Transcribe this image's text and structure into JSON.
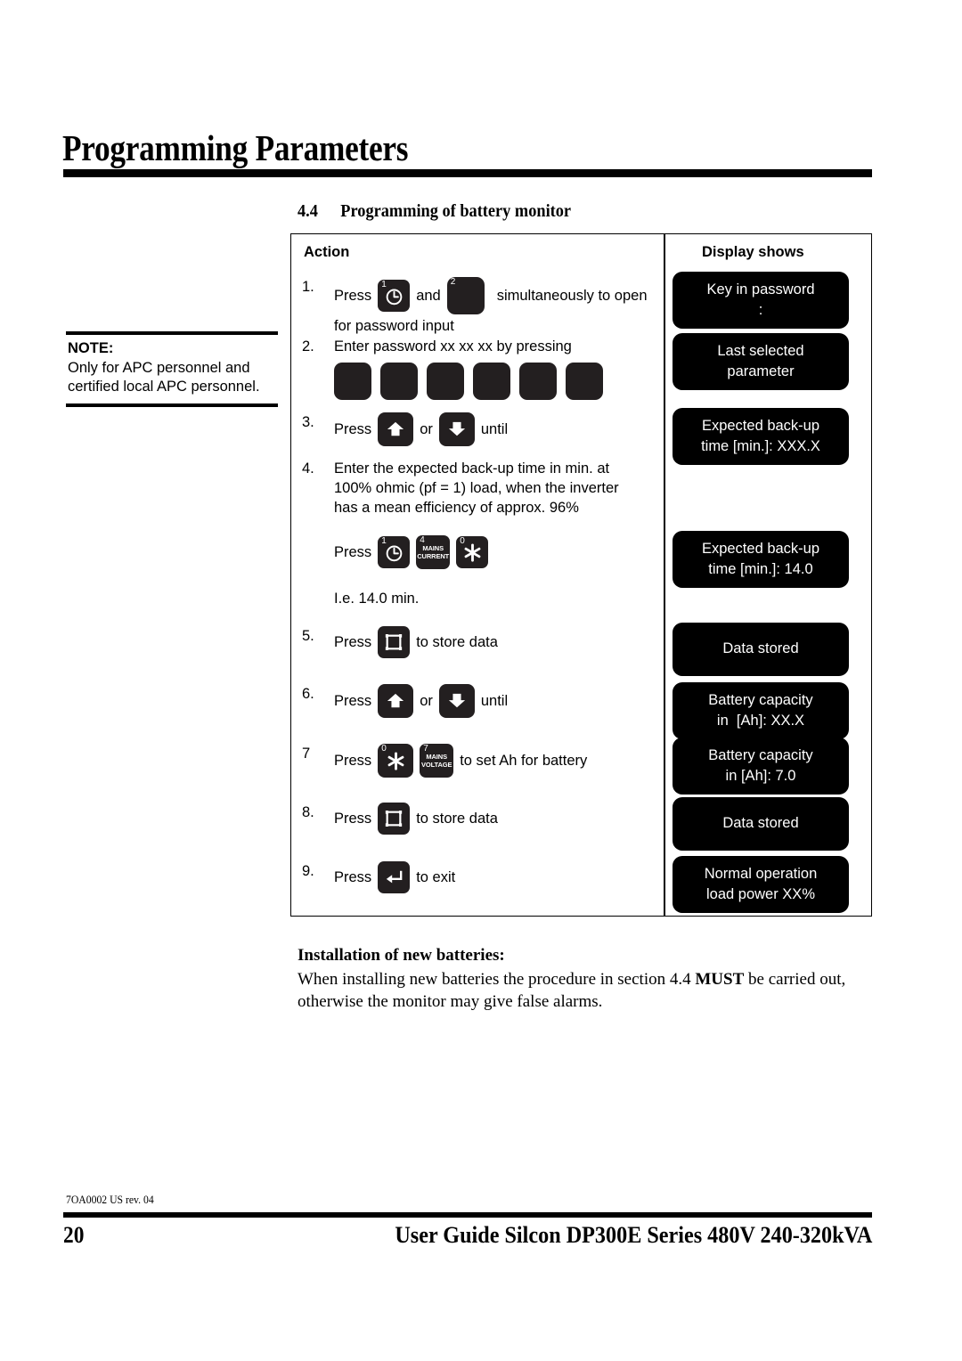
{
  "header": {
    "chapter_title": "Programming Parameters",
    "section_number": "4.4",
    "section_title": "Programming of battery monitor"
  },
  "note": {
    "label": "NOTE:",
    "line1": "Only for APC personnel and",
    "line2": "certified local APC personnel."
  },
  "table": {
    "col_action": "Action",
    "col_display": "Display shows",
    "steps": [
      {
        "no": "1.",
        "press_label": "Press",
        "and_label": "and",
        "text_line1": "simultaneously to open",
        "text_line2": "for password input",
        "keys": [
          {
            "sup": "1",
            "glyph": "clock-icon"
          },
          {
            "sup": "2",
            "glyph": "blank"
          }
        ]
      },
      {
        "no": "2.",
        "text_line1": "Enter password xx xx xx by pressing",
        "password_keys": 6
      },
      {
        "no": "3.",
        "press_label": "Press",
        "or_label": "or",
        "until_label": "until",
        "keys": [
          {
            "glyph": "arrow-up-icon"
          },
          {
            "glyph": "arrow-down-icon"
          }
        ]
      },
      {
        "no": "4.",
        "text_line1": "Enter the expected back-up time in min. at",
        "text_line2": "100% ohmic (pf = 1) load, when the inverter",
        "text_line3": "has a mean efficiency of approx. 96%",
        "press_label": "Press",
        "keys": [
          {
            "sup": "1",
            "glyph": "clock-icon"
          },
          {
            "sup": "4",
            "label1": "MAINS",
            "label2": "CURRENT"
          },
          {
            "sup": "0",
            "glyph": "asterisk-icon"
          }
        ],
        "example": "I.e. 14.0 min."
      },
      {
        "no": "5.",
        "press_label": "Press",
        "after_label": "to store data",
        "keys": [
          {
            "glyph": "store-icon"
          }
        ]
      },
      {
        "no": "6.",
        "press_label": "Press",
        "or_label": "or",
        "until_label": "until",
        "keys": [
          {
            "glyph": "arrow-up-icon"
          },
          {
            "glyph": "arrow-down-icon"
          }
        ]
      },
      {
        "no": "7",
        "press_label": "Press",
        "after_label": "to set Ah for battery",
        "keys": [
          {
            "sup": "0",
            "glyph": "asterisk-icon"
          },
          {
            "sup": "7",
            "label1": "MAINS",
            "label2": "VOLTAGE"
          }
        ]
      },
      {
        "no": "8.",
        "press_label": "Press",
        "after_label": "to store data",
        "keys": [
          {
            "glyph": "store-icon"
          }
        ]
      },
      {
        "no": "9.",
        "press_label": "Press",
        "after_label": "to exit",
        "keys": [
          {
            "glyph": "enter-icon"
          }
        ]
      }
    ],
    "displays": [
      {
        "line1": "Key in password",
        "line2": ":"
      },
      {
        "line1": "Last selected",
        "line2": "parameter"
      },
      {
        "line1": "Expected back-up",
        "line2": "time [min.]: XXX.X"
      },
      {
        "line1": "Expected back-up",
        "line2": "time [min.]: 14.0"
      },
      {
        "line1": "Data stored",
        "line2": ""
      },
      {
        "line1": "Battery capacity",
        "line2": "in  [Ah]: XX.X"
      },
      {
        "line1": "Battery capacity",
        "line2": "in [Ah]: 7.0"
      },
      {
        "line1": "Data stored",
        "line2": ""
      },
      {
        "line1": "Normal operation",
        "line2": "load power XX%"
      }
    ]
  },
  "installation": {
    "title": "Installation of new batteries:",
    "body_part1": "When installing new batteries the procedure in section 4.4 ",
    "body_emphasis": "MUST",
    "body_part2": " be carried out,",
    "body_line2": "otherwise the monitor may give false alarms."
  },
  "footer": {
    "doc_code": "7OA0002 US rev. 04",
    "page_number": "20",
    "guide_title": "User Guide Silcon DP300E Series 480V 240-320kVA"
  }
}
